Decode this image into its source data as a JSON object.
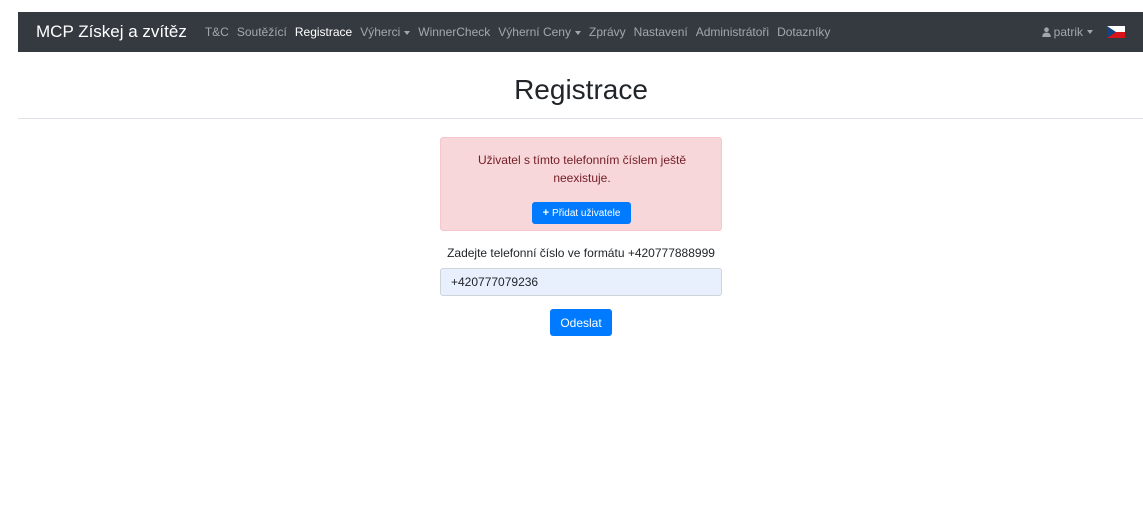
{
  "navbar": {
    "brand": "MCP Získej a zvítěz",
    "items": [
      {
        "label": "T&C",
        "active": false,
        "dropdown": false
      },
      {
        "label": "Soutěžící",
        "active": false,
        "dropdown": false
      },
      {
        "label": "Registrace",
        "active": true,
        "dropdown": false
      },
      {
        "label": "Výherci",
        "active": false,
        "dropdown": true
      },
      {
        "label": "WinnerCheck",
        "active": false,
        "dropdown": false
      },
      {
        "label": "Výherní Ceny",
        "active": false,
        "dropdown": true
      },
      {
        "label": "Zprávy",
        "active": false,
        "dropdown": false
      },
      {
        "label": "Nastavení",
        "active": false,
        "dropdown": false
      },
      {
        "label": "Administrátoři",
        "active": false,
        "dropdown": false
      },
      {
        "label": "Dotazníky",
        "active": false,
        "dropdown": false
      }
    ],
    "user": {
      "name": "patrik",
      "icon": "user-icon"
    },
    "language_flag": "czech-flag-icon"
  },
  "page": {
    "title": "Registrace"
  },
  "alert": {
    "message": "Uživatel s tímto telefonním číslem ještě neexistuje.",
    "add_button_label": "Přidat uživatele",
    "add_button_icon": "plus-icon"
  },
  "form": {
    "label": "Zadejte telefonní číslo ve formátu +420777888999",
    "phone_value": "+420777079236",
    "submit_label": "Odeslat"
  },
  "colors": {
    "navbar_bg": "#343a40",
    "primary": "#007bff",
    "alert_bg": "#f8d7da",
    "alert_text": "#721c24",
    "input_bg": "#e8f0fe"
  }
}
